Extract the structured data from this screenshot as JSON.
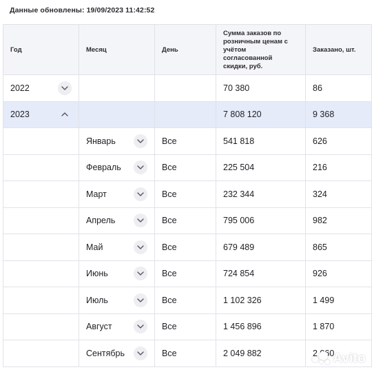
{
  "updated_label": "Данные обновлены: 19/09/2023 11:42:52",
  "columns": {
    "year": "Год",
    "month": "Месяц",
    "day": "День",
    "sum": "Сумма заказов по розничным ценам с учётом согласованной скидки, руб.",
    "ordered": "Заказано, шт."
  },
  "years": [
    {
      "year": "2022",
      "sum": "70 380",
      "ordered": "86",
      "state": "collapsed"
    },
    {
      "year": "2023",
      "sum": "7 808 120",
      "ordered": "9 368",
      "state": "expanded"
    }
  ],
  "months": [
    {
      "month": "Январь",
      "day": "Все",
      "sum": "541 818",
      "ordered": "626"
    },
    {
      "month": "Февраль",
      "day": "Все",
      "sum": "225 504",
      "ordered": "216"
    },
    {
      "month": "Март",
      "day": "Все",
      "sum": "232 344",
      "ordered": "324"
    },
    {
      "month": "Апрель",
      "day": "Все",
      "sum": "795 006",
      "ordered": "982"
    },
    {
      "month": "Май",
      "day": "Все",
      "sum": "679 489",
      "ordered": "865"
    },
    {
      "month": "Июнь",
      "day": "Все",
      "sum": "724 854",
      "ordered": "926"
    },
    {
      "month": "Июль",
      "day": "Все",
      "sum": "1 102 326",
      "ordered": "1 499"
    },
    {
      "month": "Август",
      "day": "Все",
      "sum": "1 456 896",
      "ordered": "1 870"
    },
    {
      "month": "Сентябрь",
      "day": "Все",
      "sum": "2 049 882",
      "ordered": "2 060"
    }
  ],
  "watermark": "Avito",
  "icons": {
    "collapsed": "chevron-down-icon",
    "expanded": "chevron-up-icon"
  },
  "colors": {
    "header_bg": "#f4f5f9",
    "expanded_row_bg": "#e6ebfa",
    "border": "#e1e2e8"
  }
}
